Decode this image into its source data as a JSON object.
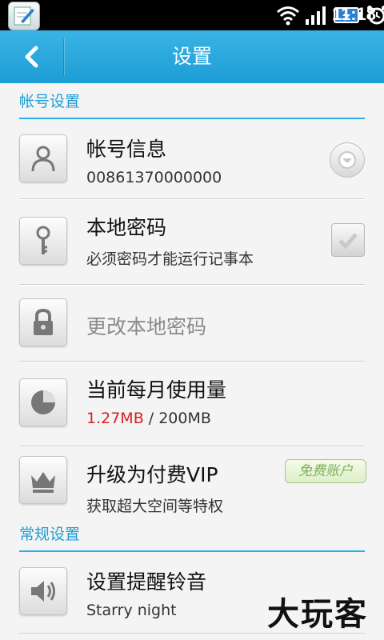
{
  "status_bar": {
    "time": "11:18",
    "icons": [
      "notepad-app-icon",
      "wifi-icon",
      "signal-icon",
      "battery-charging-icon",
      "alarm-icon"
    ]
  },
  "header": {
    "title": "设置",
    "back_icon": "chevron-left-icon"
  },
  "sections": [
    {
      "title": "帐号设置"
    },
    {
      "title": "常规设置"
    }
  ],
  "rows": {
    "account": {
      "icon": "user-icon",
      "title": "帐号信息",
      "subtitle": "00861370000000"
    },
    "local_password": {
      "icon": "key-icon",
      "title": "本地密码",
      "subtitle": "必须密码才能运行记事本",
      "checked": true
    },
    "change_password": {
      "icon": "lock-icon",
      "title": "更改本地密码",
      "enabled": false
    },
    "usage": {
      "icon": "pie-chart-icon",
      "title": "当前每月使用量",
      "used": "1.27MB",
      "separator": " / ",
      "total": "200MB"
    },
    "vip": {
      "icon": "crown-icon",
      "title": "升级为付费VIP",
      "subtitle": "获取超大空间等特权",
      "badge": "免费账户"
    },
    "ringtone": {
      "icon": "speaker-icon",
      "title": "设置提醒铃音",
      "subtitle": "Starry night"
    }
  },
  "watermark": "大玩客",
  "colors": {
    "accent": "#1c9dd6",
    "usage_used": "#d62020",
    "badge_text": "#7fb15a"
  }
}
